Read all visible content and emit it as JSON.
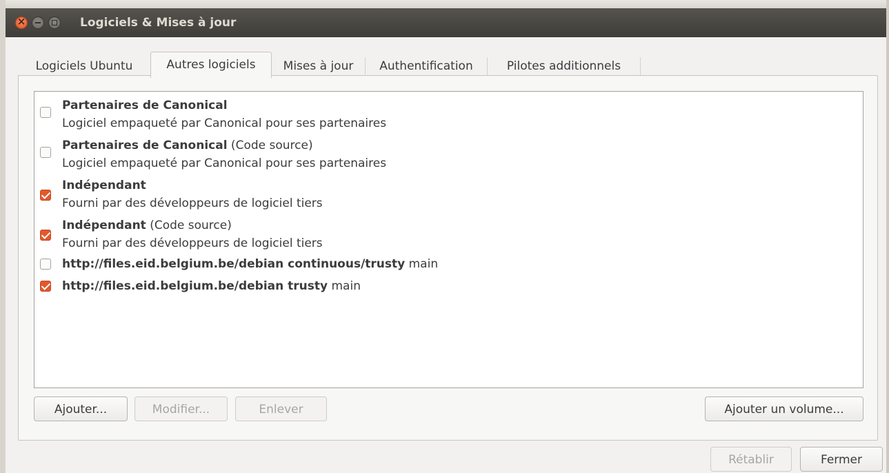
{
  "window": {
    "title": "Logiciels & Mises à jour"
  },
  "tabs": [
    {
      "label": "Logiciels Ubuntu"
    },
    {
      "label": "Autres logiciels"
    },
    {
      "label": "Mises à jour"
    },
    {
      "label": "Authentification"
    },
    {
      "label": "Pilotes additionnels"
    }
  ],
  "sources": [
    {
      "title": "Partenaires de Canonical",
      "suffix": "",
      "description": "Logiciel empaqueté par Canonical pour ses partenaires",
      "checked": false
    },
    {
      "title": "Partenaires de Canonical",
      "suffix": " (Code source)",
      "description": "Logiciel empaqueté par Canonical pour ses partenaires",
      "checked": false
    },
    {
      "title": "Indépendant",
      "suffix": "",
      "description": "Fourni par des développeurs de logiciel tiers",
      "checked": true
    },
    {
      "title": "Indépendant",
      "suffix": " (Code source)",
      "description": "Fourni par des développeurs de logiciel tiers",
      "checked": true
    },
    {
      "title": "http://files.eid.belgium.be/debian continuous/trusty",
      "suffix": " main",
      "description": "",
      "checked": false
    },
    {
      "title": "http://files.eid.belgium.be/debian trusty",
      "suffix": " main",
      "description": "",
      "checked": true
    }
  ],
  "buttons": {
    "add": "Ajouter...",
    "edit": "Modifier...",
    "remove": "Enlever",
    "add_volume": "Ajouter un volume...",
    "revert": "Rétablir",
    "close": "Fermer"
  },
  "colors": {
    "accent": "#e2582c",
    "titlebar": "#3f3d39"
  }
}
